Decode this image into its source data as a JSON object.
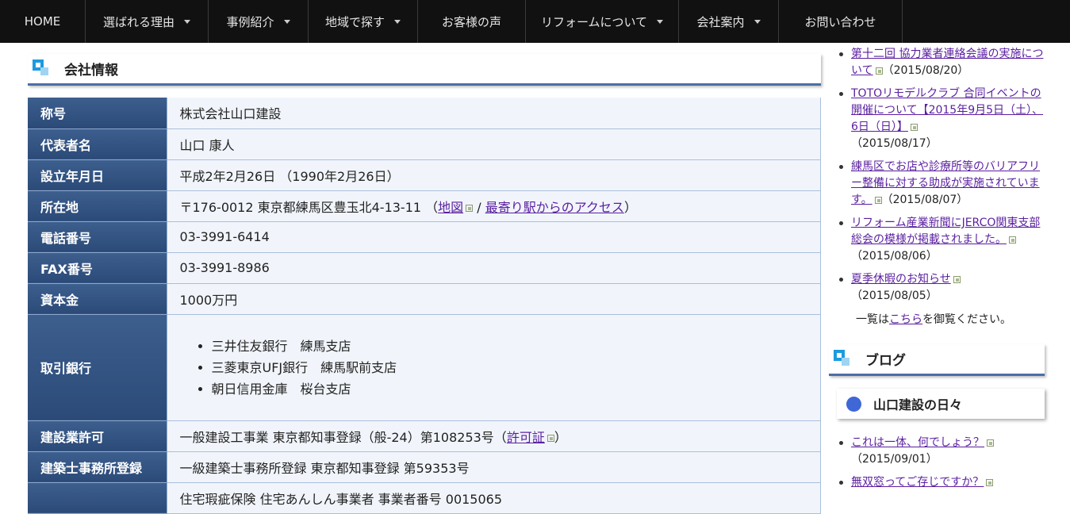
{
  "nav": [
    {
      "label": "HOME",
      "caret": false
    },
    {
      "label": "選ばれる理由",
      "caret": true
    },
    {
      "label": "事例紹介",
      "caret": true
    },
    {
      "label": "地域で探す",
      "caret": true
    },
    {
      "label": "お客様の声",
      "caret": false
    },
    {
      "label": "リフォームについて",
      "caret": true
    },
    {
      "label": "会社案内",
      "caret": true
    },
    {
      "label": "お問い合わせ",
      "caret": false
    }
  ],
  "main": {
    "title": "会社情報",
    "rows": {
      "name": {
        "label": "称号",
        "value": "株式会社山口建設"
      },
      "rep": {
        "label": "代表者名",
        "value": "山口 康人"
      },
      "founded": {
        "label": "設立年月日",
        "value": "平成2年2月26日 （1990年2月26日）"
      },
      "address": {
        "label": "所在地",
        "value": "〒176-0012 東京都練馬区豊玉北4-13-11 （",
        "map_link": "地図",
        "sep": " / ",
        "access_link": "最寄り駅からのアクセス",
        "close": "）"
      },
      "tel": {
        "label": "電話番号",
        "value": "03-3991-6414"
      },
      "fax": {
        "label": "FAX番号",
        "value": "03-3991-8986"
      },
      "capital": {
        "label": "資本金",
        "value": "1000万円"
      },
      "banks": {
        "label": "取引銀行",
        "items": [
          "三井住友銀行　練馬支店",
          "三菱東京UFJ銀行　練馬駅前支店",
          "朝日信用金庫　桜台支店"
        ]
      },
      "license": {
        "label": "建設業許可",
        "value": "一般建設工事業 東京都知事登録（般-24）第108253号（",
        "link": "許可証",
        "close": "）"
      },
      "architect": {
        "label": "建築士事務所登録",
        "value": "一級建築士事務所登録 東京都知事登録 第59353号"
      },
      "insurance": {
        "label": "",
        "value": "住宅瑕疵保険 住宅あんしん事業者 事業者番号 0015065"
      }
    }
  },
  "sidebar": {
    "news": [
      {
        "title": "第十二回 協力業者連絡会議の実施について",
        "date": "（2015/08/20）"
      },
      {
        "title": "TOTOリモデルクラブ 合同イベントの開催について【2015年9月5日（土）、6日（日）】",
        "date": "（2015/08/17）"
      },
      {
        "title": "練馬区でお店や診療所等のバリアフリー整備に対する助成が実施されています。",
        "date": "（2015/08/07）"
      },
      {
        "title": "リフォーム産業新聞にJERCO関東支部総会の模様が掲載されました。",
        "date": "（2015/08/06）"
      },
      {
        "title": "夏季休暇のお知らせ",
        "date": "（2015/08/05）"
      }
    ],
    "more_prefix": "一覧は",
    "more_link": "こちら",
    "more_suffix": "を御覧ください。",
    "blog_heading": "ブログ",
    "blog_title": "山口建設の日々",
    "blog_posts": [
      {
        "title": "これは一体、何でしょう？",
        "date": "（2015/09/01）"
      },
      {
        "title": "無双窓ってご存じですか？",
        "date": ""
      }
    ]
  }
}
